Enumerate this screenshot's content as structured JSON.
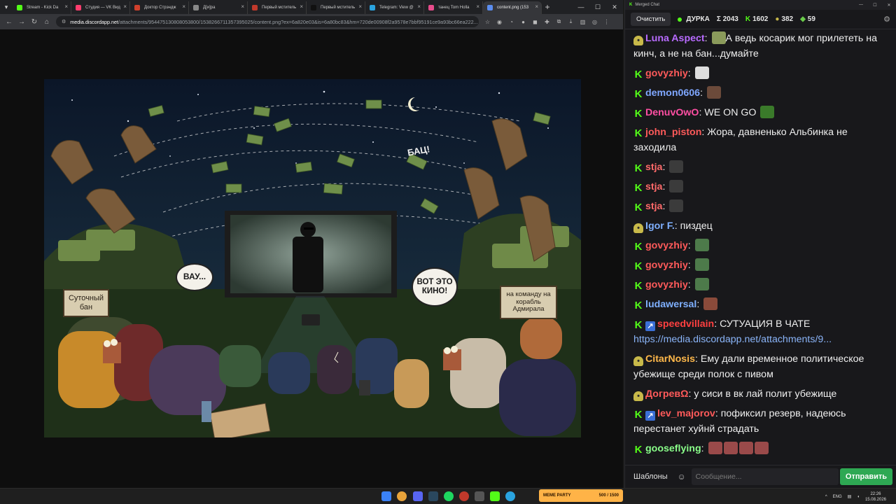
{
  "browser": {
    "tabs": [
      {
        "label": "Stream - Kick Da",
        "color": "#53fc18"
      },
      {
        "label": "Студия — VK Вид",
        "color": "#ff3d6e"
      },
      {
        "label": "Доктор Стрэндж",
        "color": "#d0402c"
      },
      {
        "label": "Д[и]ра",
        "color": "#888888"
      },
      {
        "label": "Первый мститель",
        "color": "#c0392b"
      },
      {
        "label": "Первый мститель",
        "color": "#111111"
      },
      {
        "label": "Telegram: View @",
        "color": "#2aa3df"
      },
      {
        "label": "танец Tom Holla",
        "color": "#e84c8b"
      },
      {
        "label": "content.png (153",
        "color": "#5b8def",
        "active": true
      }
    ],
    "new_tab": "+",
    "url_host": "media.discordapp.net",
    "url_path": "/attachments/954475130808053800/1538266711357395025/content.png?ex=6a820e03&is=6a80bc83&hm=720de00908f2a9578e7bbf95191ce9a93bc66ea222..."
  },
  "picture": {
    "bubble_left": "ВАУ...",
    "bubble_right": "ВОТ ЭТО КИНО!",
    "bang": "БАЦ!",
    "sign_left": "Суточный бан",
    "sign_right": "на команду на корабль Адмирала"
  },
  "chat": {
    "window_title": "Merged Chat",
    "clear_label": "Очистить",
    "channel_name": "ДУРКА",
    "stats": {
      "total": "Σ 2043",
      "kick": "1602",
      "other": "382",
      "third": "59"
    },
    "messages": [
      {
        "badge": "bot",
        "user": "Luna Aspect",
        "color": "#b86bff",
        "text": "А ведь косарик мог прилететь на кинч, а не на бан...думайте",
        "emote": "#8a9a5b",
        "emote_before": true
      },
      {
        "badge": "kick",
        "user": "govyzhiy",
        "color": "#ff5a5a",
        "text": "",
        "emote": "#dddddd"
      },
      {
        "badge": "kick",
        "user": "demon0606",
        "color": "#7fa7ff",
        "text": "",
        "emote": "#6b4a3a"
      },
      {
        "badge": "kick",
        "user": "DenuvOwO",
        "color": "#ff4fa3",
        "text": "WE ON GO",
        "emote": "#3a7a2a"
      },
      {
        "badge": "kick",
        "user": "john_piston",
        "color": "#ff5a5a",
        "text": "Жора, давненько Альбинка не заходила",
        "emote": ""
      },
      {
        "badge": "kick",
        "user": "stja",
        "color": "#ff6a6a",
        "text": "",
        "emote": "#3b3b3b"
      },
      {
        "badge": "kick",
        "user": "stja",
        "color": "#ff6a6a",
        "text": "",
        "emote": "#3b3b3b"
      },
      {
        "badge": "kick",
        "user": "stja",
        "color": "#ff6a6a",
        "text": "",
        "emote": "#3b3b3b"
      },
      {
        "badge": "bot",
        "user": "Igor F.",
        "color": "#7fb0ff",
        "text": "пиздец",
        "emote": ""
      },
      {
        "badge": "kick",
        "user": "govyzhiy",
        "color": "#ff5a5a",
        "text": "",
        "emote": "#4d7a4a"
      },
      {
        "badge": "kick",
        "user": "govyzhiy",
        "color": "#ff5a5a",
        "text": "",
        "emote": "#4d7a4a"
      },
      {
        "badge": "kick",
        "user": "govyzhiy",
        "color": "#ff5a5a",
        "text": "",
        "emote": "#4d7a4a"
      },
      {
        "badge": "kick",
        "user": "ludawersal",
        "color": "#7fb0ff",
        "text": "",
        "emote": "#8a4a3a"
      },
      {
        "badge": "kick+pin",
        "user": "speedvillain",
        "color": "#ff4040",
        "text": "СУТУАЦИЯ В ЧАТЕ",
        "link": "https://media.discordapp.net/attachments/9..."
      },
      {
        "badge": "bot",
        "user": "CitarNosis",
        "color": "#ffb84a",
        "text": "Ему дали временное политическое убежище среди полок с пивом",
        "emote": ""
      },
      {
        "badge": "bot",
        "user": "ДогревΩ",
        "color": "#ff5a5a",
        "text": "у сиси в вк лай полит убежище",
        "emote": ""
      },
      {
        "badge": "kick+pin",
        "user": "lev_majorov",
        "color": "#ff5a5a",
        "text": "пофиксил резерв, надеюсь перестанет хуйнй страдать",
        "emote": ""
      },
      {
        "badge": "kick",
        "user": "gooseflying",
        "color": "#8aff8a",
        "text": "",
        "emote": "#9a4a4a",
        "emote_count": 4
      }
    ],
    "templates_label": "Шаблоны",
    "input_placeholder": "Сообщение...",
    "send_label": "Отправить"
  },
  "taskbar": {
    "widget_title": "MEME PARTY",
    "widget_progress": "500 / 1500",
    "lang": "ENG",
    "time": "22:26",
    "date": "15.08.2026"
  }
}
